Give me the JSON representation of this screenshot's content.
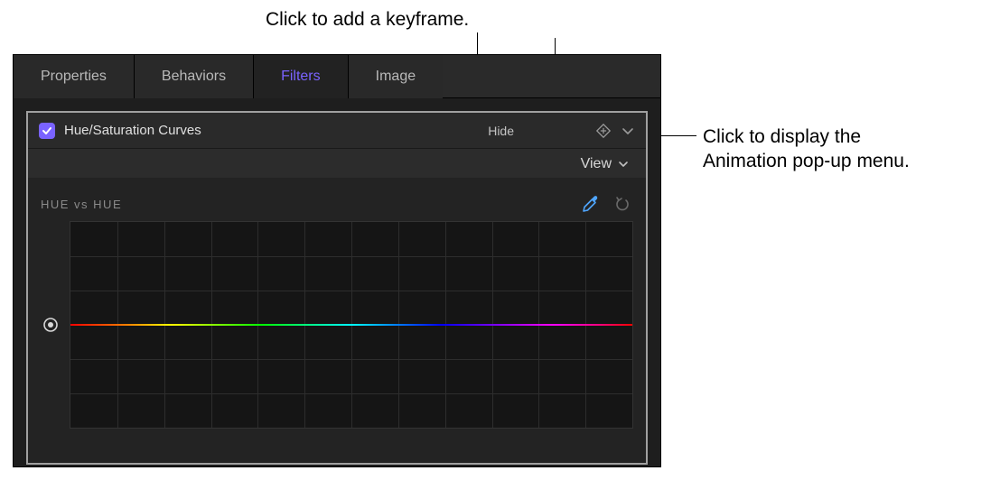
{
  "callouts": {
    "keyframe": "Click to add a keyframe.",
    "animation_menu_line1": "Click to display the",
    "animation_menu_line2": "Animation pop-up menu."
  },
  "tabs": {
    "properties": "Properties",
    "behaviors": "Behaviors",
    "filters": "Filters",
    "image": "Image"
  },
  "filter": {
    "title": "Hue/Saturation Curves",
    "hide_label": "Hide",
    "view_label": "View"
  },
  "section": {
    "hue_vs_hue": "HUE vs HUE"
  }
}
